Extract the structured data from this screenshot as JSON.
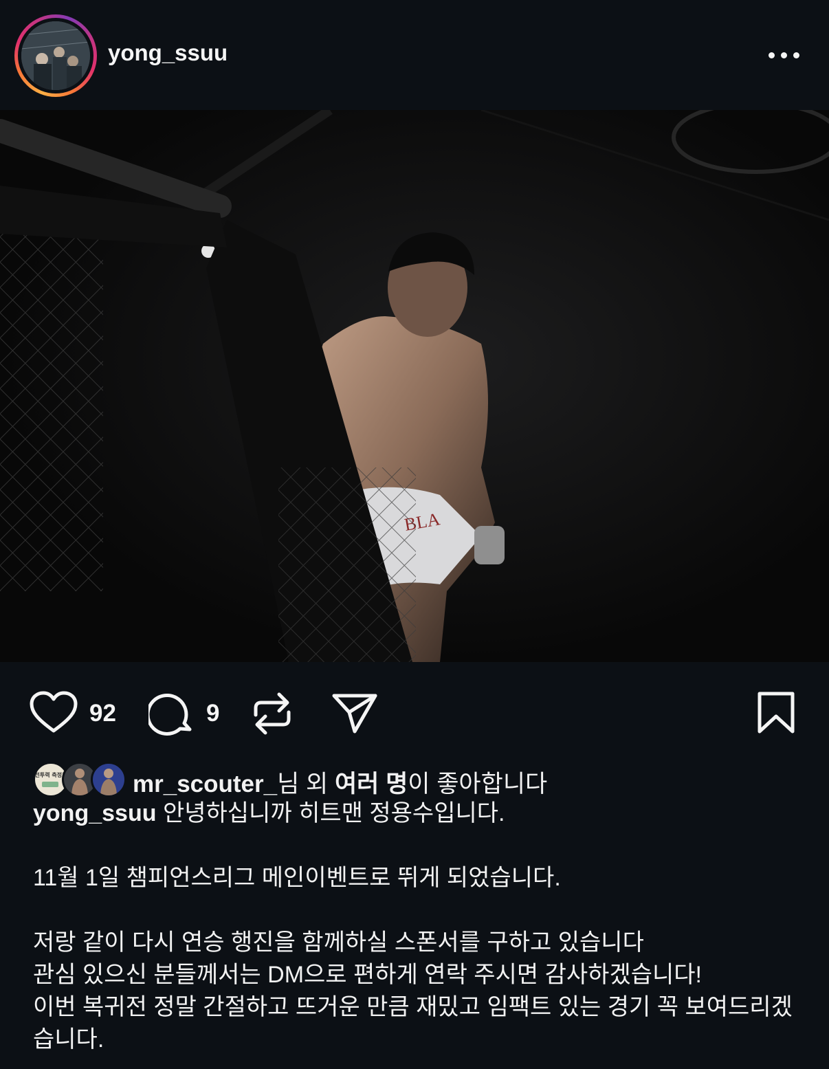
{
  "post": {
    "username": "yong_ssuu"
  },
  "actions": {
    "like_count": "92",
    "comment_count": "9"
  },
  "likes": {
    "liker": "mr_scouter_",
    "mid": "님 외 ",
    "others": "여러 명",
    "suffix": "이 좋아합니다",
    "avatar1_text": "전투력 측정기"
  },
  "caption": {
    "author": "yong_ssuu",
    "line1": "안녕하십니까 히트맨 정용수입니다.",
    "line2": "11월 1일 챔피언스리그 메인이벤트로 뛰게 되었습니다.",
    "line3": "저랑 같이 다시 연승 행진을 함께하실 스폰서를 구하고 있습니다",
    "line4": "관심 있으신 분들께서는 DM으로 편하게 연락 주시면 감사하겠습니다!",
    "line5": "이번 복귀전 정말 간절하고 뜨거운 만큼 재밌고 임팩트 있는 경기 꼭 보여드리겠",
    "line6": "습니다."
  },
  "icons": {
    "more": "more-options-icon",
    "like": "heart-icon",
    "comment": "comment-icon",
    "repost": "repost-icon",
    "share": "send-icon",
    "save": "bookmark-icon"
  },
  "colors": {
    "background": "#0c1015",
    "text": "#f2f2f2",
    "story_ring": [
      "#fcaf45",
      "#f77737",
      "#e1306c",
      "#c13584",
      "#833ab4"
    ]
  }
}
